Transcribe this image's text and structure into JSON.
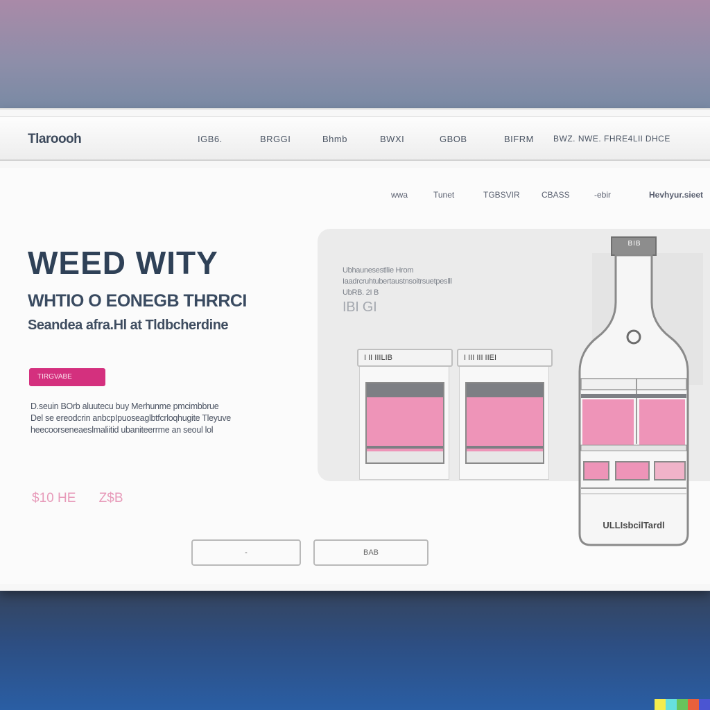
{
  "brand": "Tlaroooh",
  "top_nav": [
    "IGB6.",
    "BRGGI",
    "Bhmb",
    "BWXI",
    "GBOB",
    "BIFRM",
    "BWZ. NWE.  FHRE4LIl  DHCE"
  ],
  "sub_nav": [
    "wwa",
    "Tunet",
    "TGBSVIR",
    "CBASS",
    "-ebir",
    "Hevhyur.sieet"
  ],
  "hero": {
    "title": "WEED WITY",
    "subtitle": "WHTIO  O  EONEGB  THRRCI",
    "tagline": "Seandea  afra.Hl  at  Tldbcherdine",
    "cta": "TIRGVABE",
    "description": [
      "D.seuin  BOrb  aluutecu  buy  Merhunme  pmcimbbrue",
      "Del  se  ereodcrin  anbcpIpuoseaglbtfcrloqhugite  Tleyuve",
      "heecoorseneaeslmaliitid  ubaniteerrme  an  seoul  lol"
    ],
    "price_old": "$10  HE",
    "price_new": "Z$B"
  },
  "buttons": {
    "secondary": "-",
    "primary": "BAB"
  },
  "panel": {
    "line1": "Ubhaunesestllie          Hrom",
    "line2": "Iaadrcruhtubertaustnsoitrsuetpeslll",
    "line3": "UbRB.  2I  B",
    "big": "IBI GI",
    "cards": [
      {
        "header": "I  II  IIILIB"
      },
      {
        "header": "I  III  III  IIEI"
      }
    ]
  },
  "bottle": {
    "cap": "BIB",
    "label": "ULLIsbcilTardl"
  },
  "colors": {
    "accent": "#d4307e",
    "pink": "#ee94b8",
    "heading": "#2f4157"
  }
}
